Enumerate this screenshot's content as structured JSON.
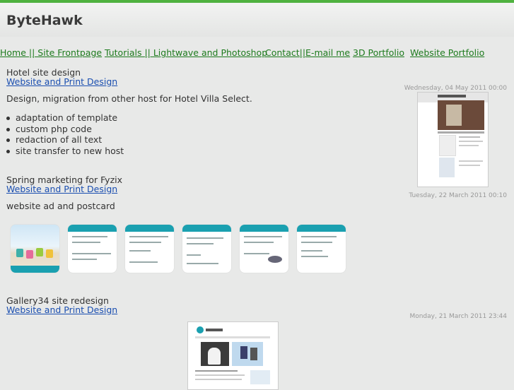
{
  "site": {
    "title": "ByteHawk"
  },
  "nav": [
    {
      "label": "Home || Site Frontpage"
    },
    {
      "label": "Tutorials || Lightwave and Photoshop"
    },
    {
      "label": "Contact||E-mail me"
    },
    {
      "label": "3D Portfolio"
    },
    {
      "label": "Website Portfolio"
    }
  ],
  "posts": [
    {
      "title": "Hotel site design",
      "category": "Website and Print Design",
      "date": "Wednesday, 04 May 2011 00:00",
      "intro": "Design, migration from other host for Hotel Villa Select.",
      "bullets": [
        "adaptation of template",
        "custom php code",
        "redaction of all text",
        "site transfer to new host"
      ]
    },
    {
      "title": "Spring marketing for Fyzix",
      "category": "Website and Print Design",
      "date": "Tuesday, 22 March 2011 00:10",
      "intro": "website ad and postcard"
    },
    {
      "title": "Gallery34 site redesign",
      "category": "Website and Print Design",
      "date": "Monday, 21 March 2011 23:44"
    }
  ],
  "colors": {
    "accent_green": "#4fb23f",
    "nav_link": "#1d7a1d",
    "category_link": "#1a4eb0",
    "thumb_teal": "#1aa0b0"
  }
}
